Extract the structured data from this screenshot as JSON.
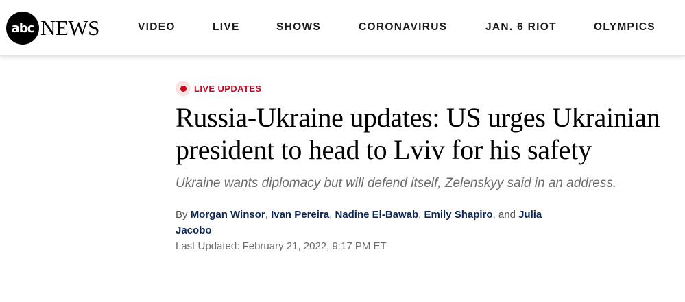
{
  "header": {
    "logo_mark": "abc",
    "logo_text": "NEWS",
    "nav": [
      {
        "label": "VIDEO"
      },
      {
        "label": "LIVE"
      },
      {
        "label": "SHOWS"
      },
      {
        "label": "CORONAVIRUS"
      },
      {
        "label": "JAN. 6 RIOT"
      },
      {
        "label": "OLYMPICS"
      }
    ]
  },
  "article": {
    "tag": "LIVE UPDATES",
    "tag_color": "#d0021b",
    "headline": "Russia-Ukraine updates: US urges Ukrainian president to head to Lviv for his safety",
    "dek": "Ukraine wants diplomacy but will defend itself, Zelenskyy said in an address.",
    "byline": {
      "prefix": "By",
      "authors": [
        "Morgan Winsor",
        "Ivan Pereira",
        "Nadine El-Bawab",
        "Emily Shapiro",
        "Julia Jacobo"
      ],
      "separator": ",",
      "conjunction": "and"
    },
    "last_updated": "Last Updated: February 21, 2022, 9:17 PM ET"
  }
}
